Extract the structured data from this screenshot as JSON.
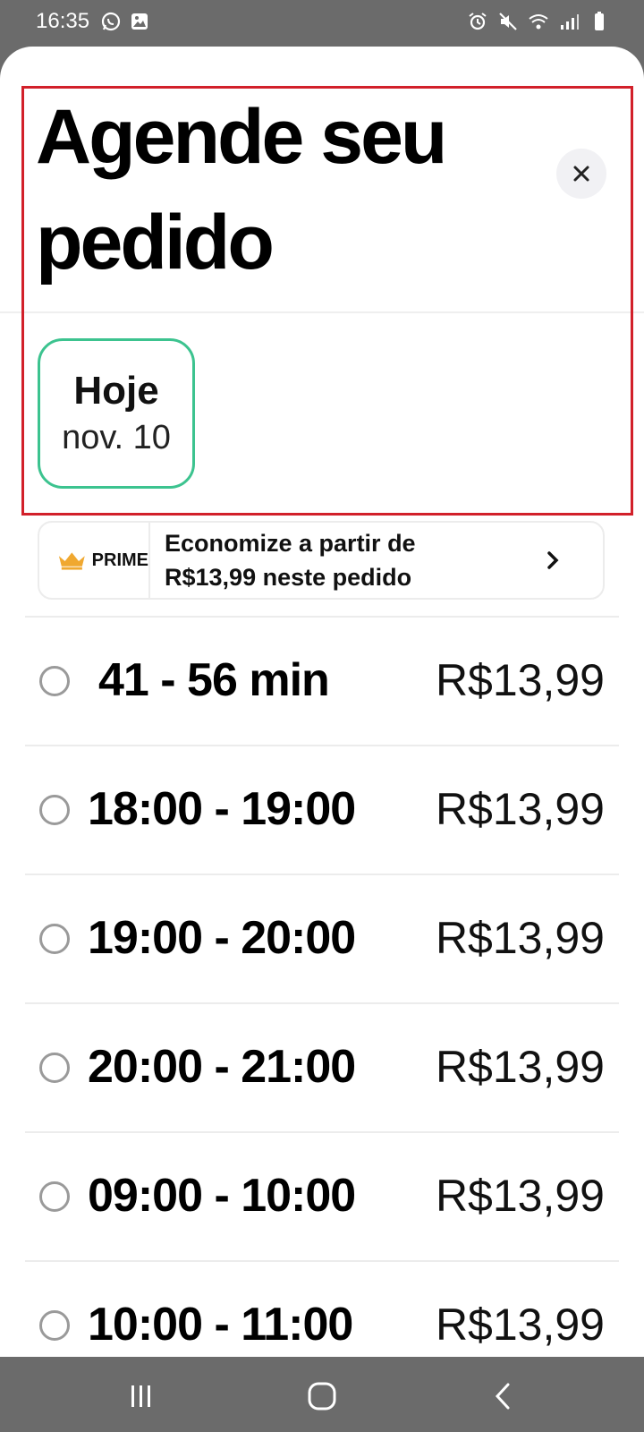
{
  "status_bar": {
    "time": "16:35"
  },
  "sheet": {
    "title": "Agende seu pedido",
    "close_icon": "close-icon",
    "date_chip": {
      "day": "Hoje",
      "date": "nov. 10"
    },
    "prime_banner": {
      "label": "PRIME",
      "message": "Economize a partir de R$13,99 neste pedido"
    },
    "slots": [
      {
        "time": "41 - 56 min",
        "price": "R$13,99"
      },
      {
        "time": "18:00 - 19:00",
        "price": "R$13,99"
      },
      {
        "time": "19:00 - 20:00",
        "price": "R$13,99"
      },
      {
        "time": "20:00 - 21:00",
        "price": "R$13,99"
      },
      {
        "time": "09:00 - 10:00",
        "price": "R$13,99"
      },
      {
        "time": "10:00 - 11:00",
        "price": "R$13,99"
      }
    ]
  },
  "colors": {
    "accent_green": "#3cc38f",
    "highlight_red": "#d2202a",
    "prime_gold": "#f0a830",
    "system_gray": "#6b6b6b"
  },
  "nav_bar": {
    "recents_icon": "recents-icon",
    "home_icon": "home-icon",
    "back_icon": "back-icon"
  }
}
